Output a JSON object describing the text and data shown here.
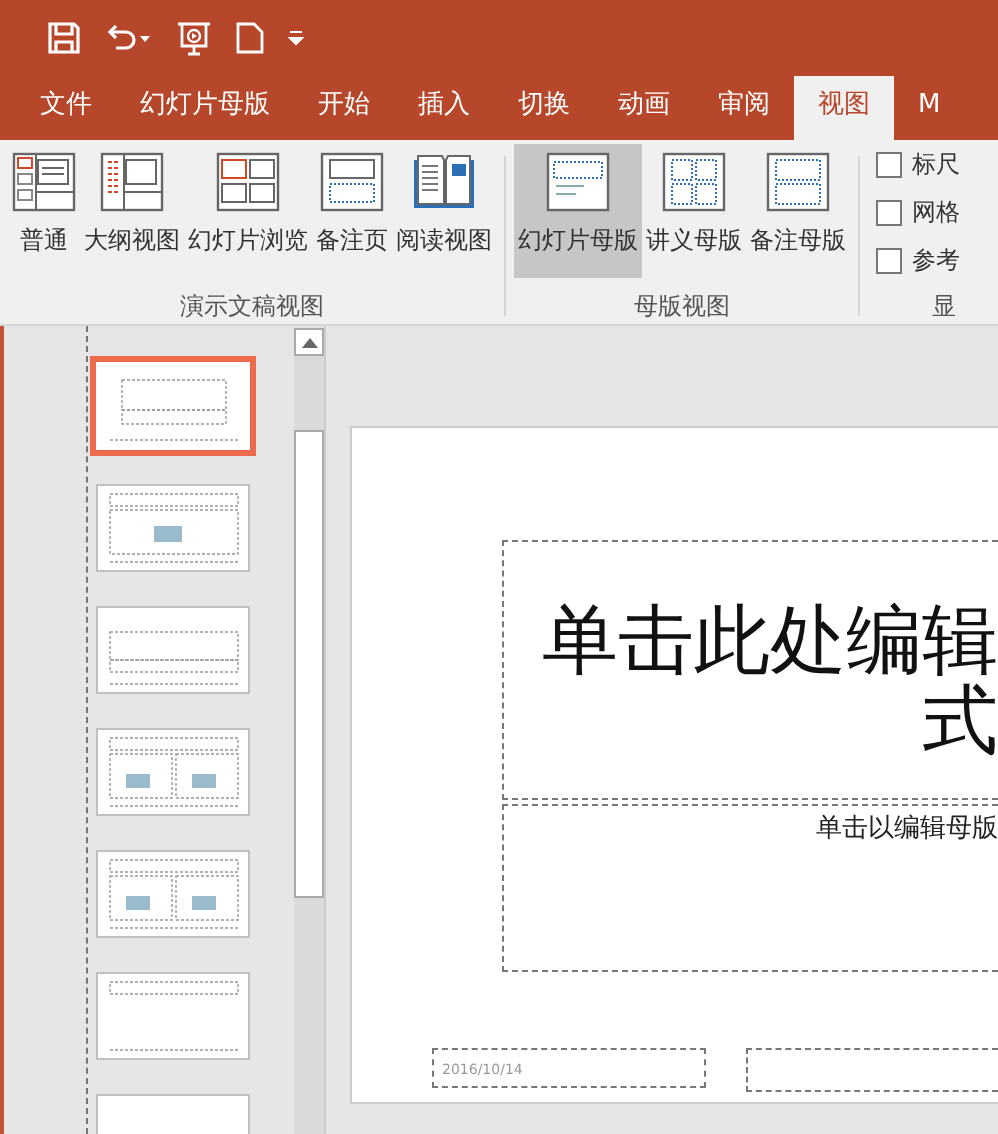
{
  "quick_access": [
    {
      "kind": "save"
    },
    {
      "kind": "undo"
    },
    {
      "kind": "present"
    },
    {
      "kind": "new"
    },
    {
      "kind": "customize"
    }
  ],
  "tabs": [
    {
      "label": "文件",
      "selected": false
    },
    {
      "label": "幻灯片母版",
      "selected": false
    },
    {
      "label": "开始",
      "selected": false
    },
    {
      "label": "插入",
      "selected": false
    },
    {
      "label": "切换",
      "selected": false
    },
    {
      "label": "动画",
      "selected": false
    },
    {
      "label": "审阅",
      "selected": false
    },
    {
      "label": "视图",
      "selected": true
    },
    {
      "label": "M",
      "selected": false
    }
  ],
  "ribbon": {
    "groups": [
      {
        "label": "演示文稿视图",
        "buttons": [
          {
            "label": "普通",
            "kind": "normal",
            "selected": false
          },
          {
            "label": "大纲视图",
            "kind": "outline",
            "selected": false
          },
          {
            "label": "幻灯片浏览",
            "kind": "sorter",
            "selected": false
          },
          {
            "label": "备注页",
            "kind": "notes",
            "selected": false
          },
          {
            "label": "阅读视图",
            "kind": "reading",
            "selected": false
          }
        ]
      },
      {
        "label": "母版视图",
        "buttons": [
          {
            "label": "幻灯片母版",
            "kind": "slidemaster",
            "selected": true
          },
          {
            "label": "讲义母版",
            "kind": "handout",
            "selected": false
          },
          {
            "label": "备注母版",
            "kind": "notesmaster",
            "selected": false
          }
        ]
      }
    ],
    "checkboxes": [
      {
        "label": "标尺",
        "checked": false
      },
      {
        "label": "网格",
        "checked": false
      },
      {
        "label": "参考",
        "checked": false
      }
    ],
    "show_group_label": "显"
  },
  "thumbnails": [
    {
      "kind": "title",
      "selected": true
    },
    {
      "kind": "content",
      "selected": false
    },
    {
      "kind": "section",
      "selected": false
    },
    {
      "kind": "two",
      "selected": false
    },
    {
      "kind": "compare",
      "selected": false
    },
    {
      "kind": "titleonly",
      "selected": false
    },
    {
      "kind": "blank",
      "selected": false
    }
  ],
  "slide": {
    "title_lines": [
      "单击此处编辑",
      "式"
    ],
    "subtitle": "单击以编辑母版",
    "date": "2016/10/14"
  }
}
